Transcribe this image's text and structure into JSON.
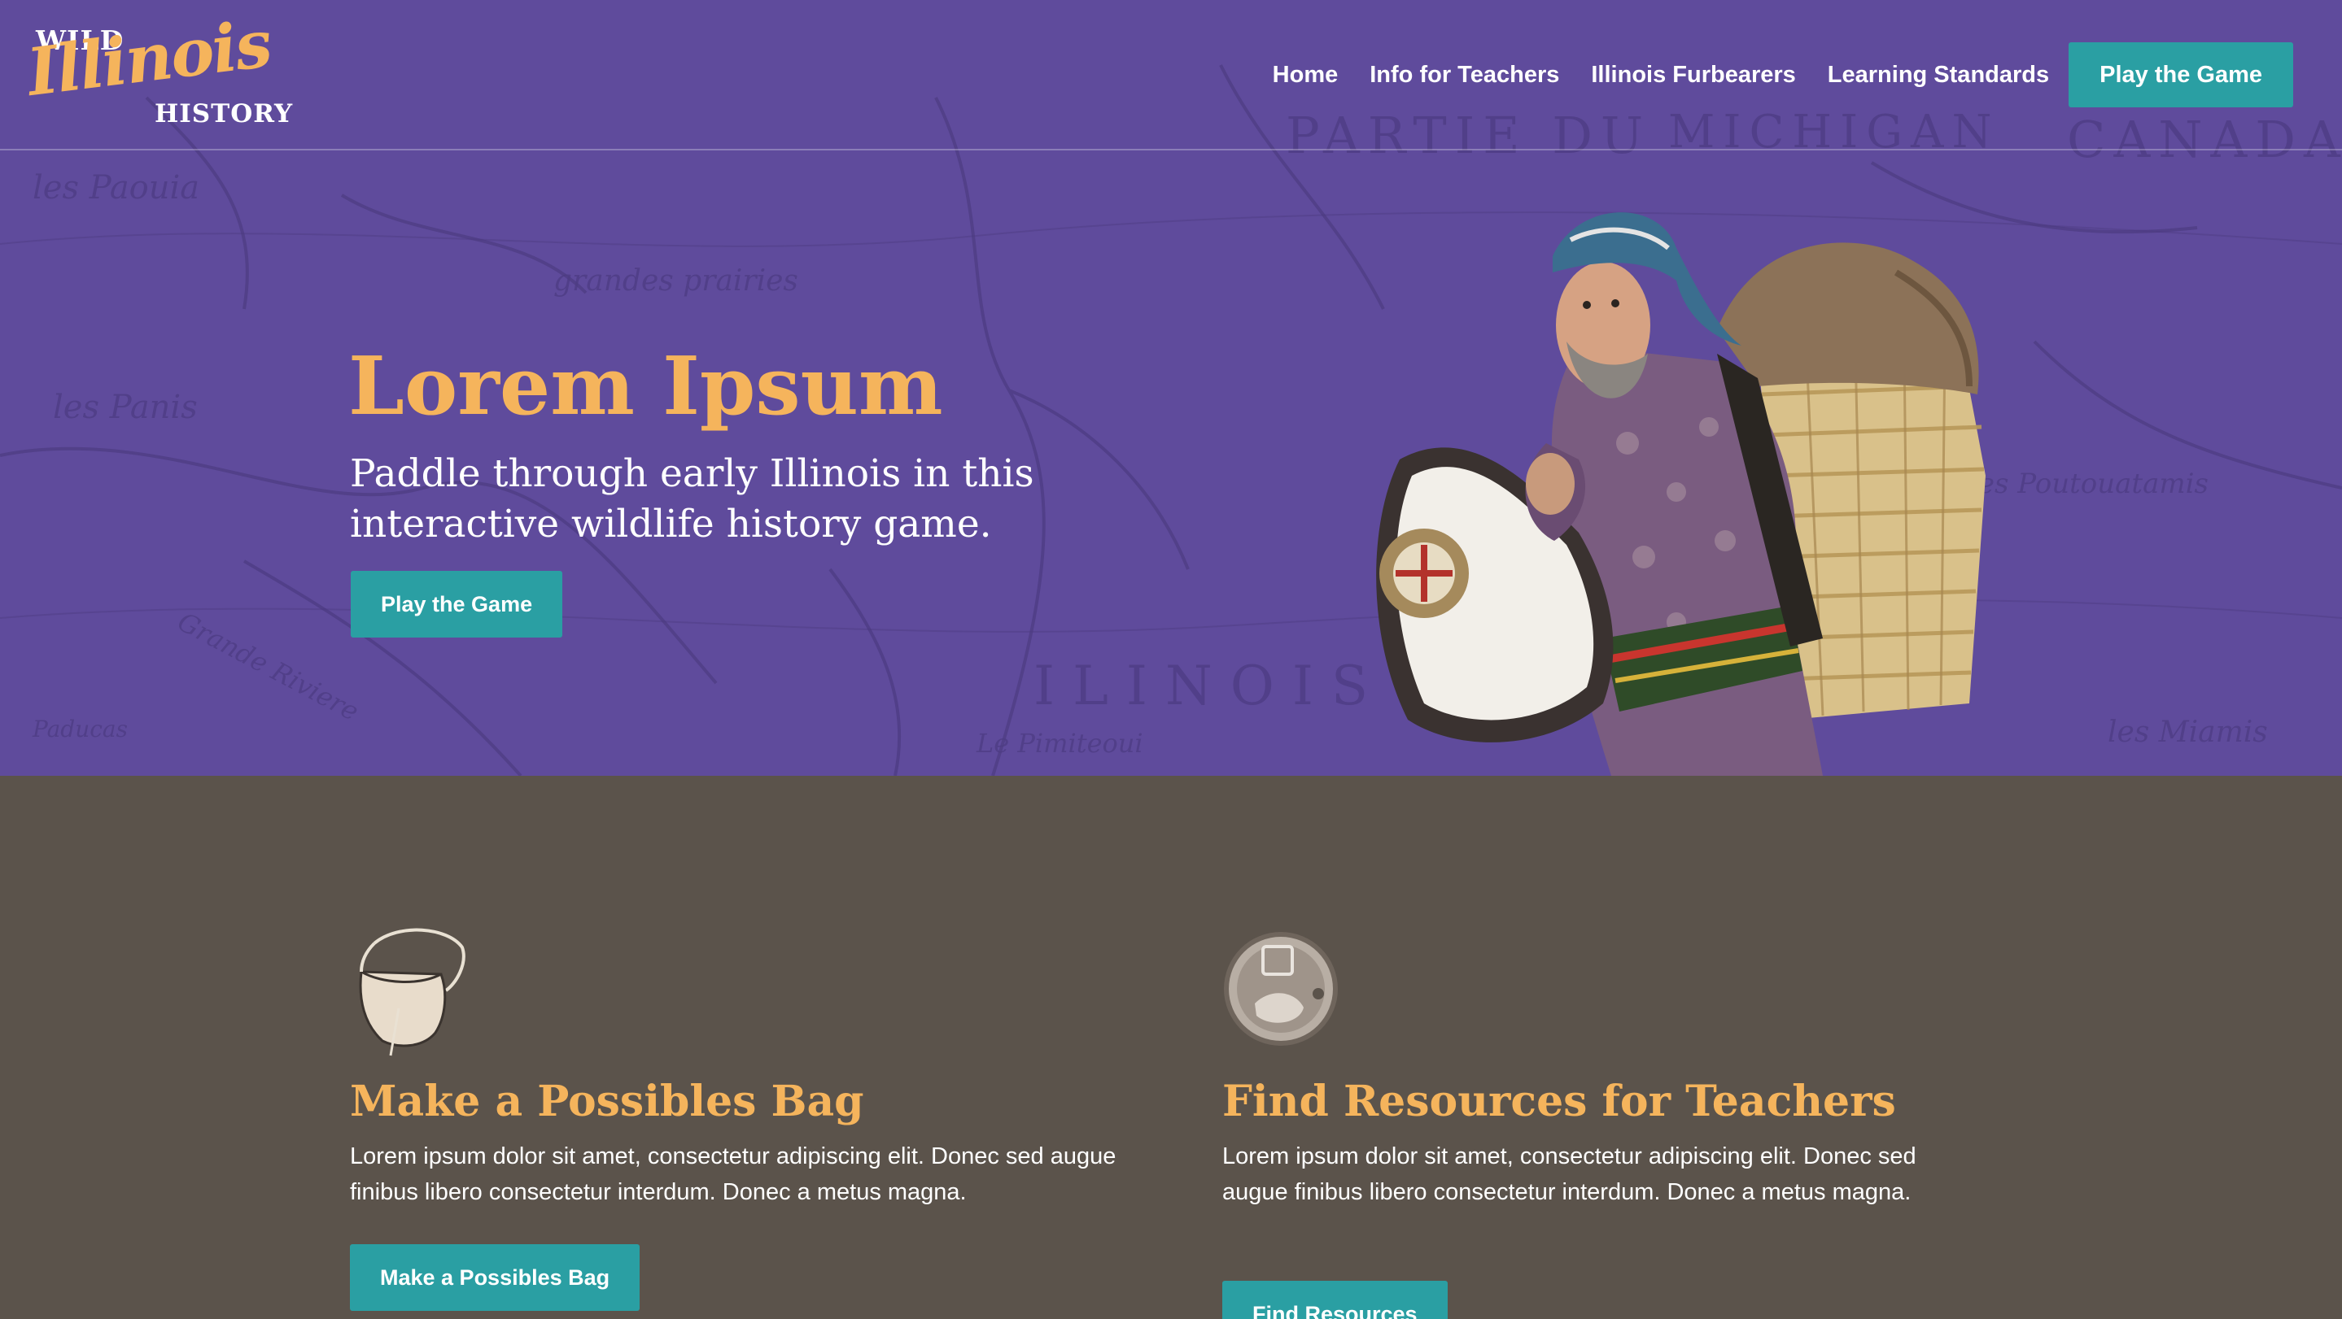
{
  "header": {
    "logo": {
      "line1": "WILD",
      "line2": "Illinois",
      "line3": "HISTORY"
    },
    "nav": [
      {
        "label": "Home"
      },
      {
        "label": "Info for Teachers"
      },
      {
        "label": "Illinois Furbearers"
      },
      {
        "label": "Learning Standards"
      }
    ],
    "cta_label": "Play the Game"
  },
  "hero": {
    "title": "Lorem Ipsum",
    "subtitle": "Paddle through early Illinois in this interactive wildlife history game.",
    "button_label": "Play the Game",
    "map_labels": [
      "les Paouia",
      "PARTIE DU",
      "MICHIGAN",
      "CANADA",
      "les Panis",
      "grandes prairies",
      "ILINOIS",
      "les Miamis",
      "les Poutouatamis",
      "Paducas",
      "Le Pimiteoui",
      "Grande Riviere"
    ]
  },
  "features": [
    {
      "icon": "possibles-bag-icon",
      "title": "Make a Possibles Bag",
      "text": "Lorem ipsum dolor sit amet, consectetur adipiscing elit. Donec sed augue finibus libero consectetur interdum. Donec a metus magna.",
      "button_label": "Make a Possibles Bag"
    },
    {
      "icon": "silver-coin-icon",
      "title": "Find Resources for Teachers",
      "text": "Lorem ipsum dolor sit amet, consectetur adipiscing elit. Donec sed augue finibus libero consectetur interdum. Donec a metus magna.",
      "button_label": "Find Resources"
    }
  ],
  "colors": {
    "hero_bg": "#5f4b9c",
    "accent_gold": "#f5b45c",
    "button_teal": "#2a9fa3",
    "section_bg": "#5b534b"
  }
}
